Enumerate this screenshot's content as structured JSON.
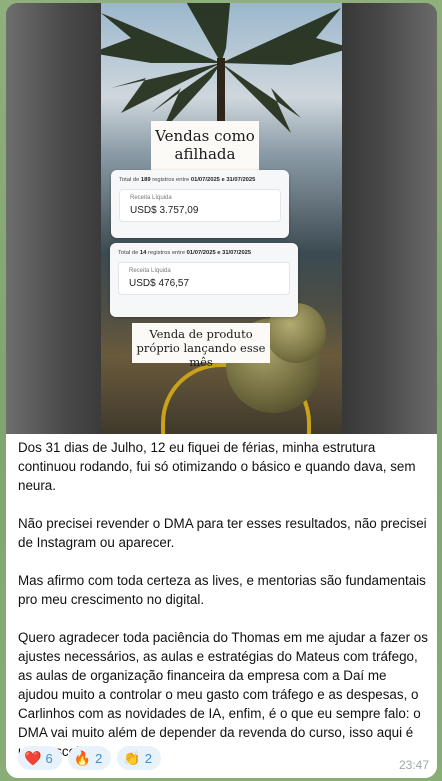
{
  "media": {
    "caption_top": "Vendas como afilhada",
    "caption_bottom": "Venda de produto próprio lançando esse mês",
    "card1": {
      "summary_prefix": "Total de ",
      "summary_count": "189",
      "summary_mid": " registros entre ",
      "summary_range": "01/07/2025 e 31/07/2025",
      "label": "Receita Líquida",
      "value": "USD$ 3.757,09"
    },
    "card2": {
      "summary_prefix": "Total de ",
      "summary_count": "14",
      "summary_mid": " registros entre ",
      "summary_range": "01/07/2025 e 31/07/2025",
      "label": "Receita Líquida",
      "value": "USD$ 476,57"
    }
  },
  "message": {
    "paragraphs": [
      "Dos 31 dias de Julho, 12 eu fiquei de férias, minha estrutura continuou rodando, fui só otimizando o básico e quando dava, sem neura.",
      "Não precisei revender o DMA para ter esses resultados, não precisei de Instagram ou aparecer.",
      "Mas afirmo com toda certeza as lives, e mentorias são  fundamentais pro meu crescimento no digital.",
      "Quero agradecer toda paciência do Thomas em me ajudar a fazer os ajustes necessários, as aulas e estratégias do Mateus com tráfego, as aulas de organização financeira da empresa com a Daí me ajudou muito a controlar o meu gasto com tráfego e as despesas,  o Carlinhos com as novidades de IA, enfim, é o que eu sempre falo: o DMA vai muito além de depender da revenda do curso, isso aqui é uma escola!"
    ],
    "time": "23:47"
  },
  "reactions": [
    {
      "emoji": "❤️",
      "icon": "heart-icon",
      "count": "6"
    },
    {
      "emoji": "🔥",
      "icon": "fire-icon",
      "count": "2"
    },
    {
      "emoji": "👏",
      "icon": "clapping-hands-icon",
      "count": "2"
    }
  ],
  "colors": {
    "chat_background": "#8fb07a",
    "bubble": "#ffffff",
    "reaction_bg": "#e8f2fb",
    "reaction_text": "#3a8fd6",
    "timestamp": "#a0a7ad"
  }
}
